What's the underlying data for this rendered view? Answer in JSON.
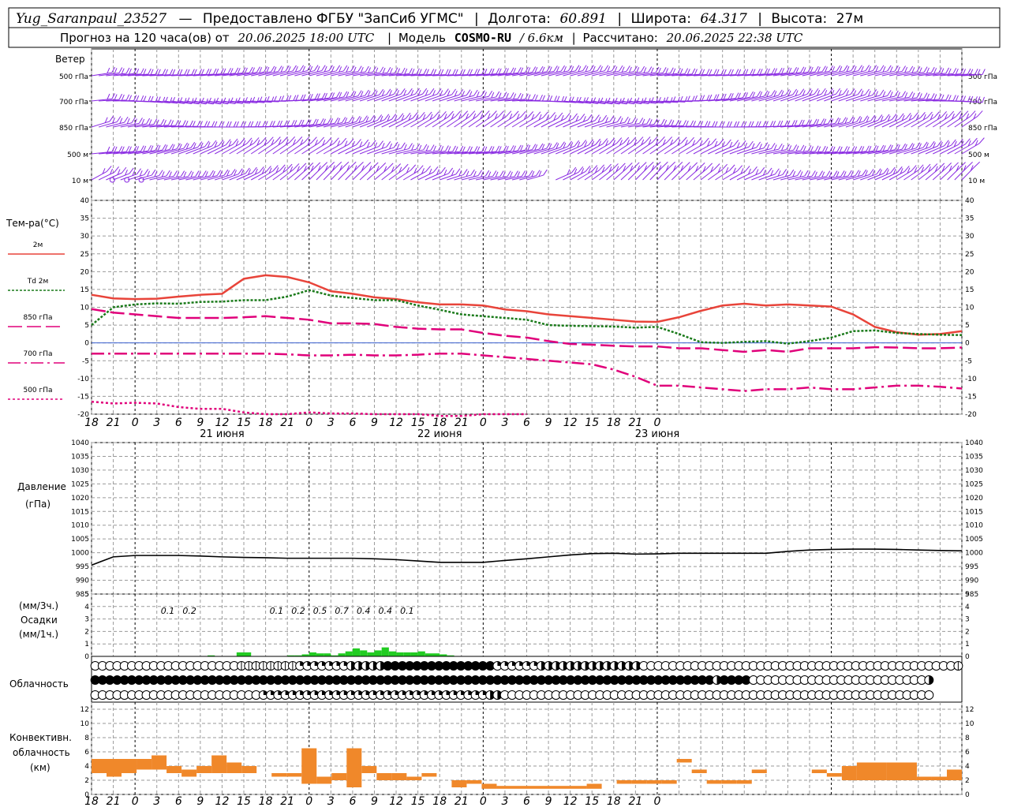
{
  "header": {
    "station": "Yug_Saranpaul_23527",
    "dash": "—",
    "provider": "Предоставлено ФГБУ \"ЗапСиб УГМС\"",
    "lon_label": "Долгота:",
    "lon_value": "60.891",
    "lat_label": "Широта:",
    "lat_value": "64.317",
    "alt_label": "Высота:",
    "alt_value": "27м",
    "forecast_prefix": "Прогноз на 120 часа(ов) от",
    "forecast_time": "20.06.2025 18:00 UTC",
    "model_label": "Модель",
    "model_name": "COSMO-RU",
    "model_res": "/ 6.6км",
    "calc_label": "Рассчитано:",
    "calc_time": "20.06.2025 22:38 UTC"
  },
  "colors": {
    "wind": "#8a2be2",
    "t2m": "#e8443a",
    "td2m": "#1a7a1a",
    "t850": "#e0007a",
    "t700": "#e0007a",
    "t500": "#e0007a",
    "pressure": "#000000",
    "precip": "#22cc22",
    "convective": "#f0882a",
    "grid": "#9a9a9a"
  },
  "labels": {
    "wind_title": "Ветер",
    "wind_levels": [
      "500 гПа",
      "700 гПа",
      "850 гПа",
      "500 м",
      "10 м"
    ],
    "temp_title": "Тем-ра(°C)",
    "temp_legend": [
      "2м",
      "Td 2м",
      "850 гПа",
      "700 гПа",
      "500 гПа"
    ],
    "pressure_title": "Давление",
    "pressure_unit": "(гПа)",
    "precip_unit1": "(мм/3ч.)",
    "precip_title": "Осадки",
    "precip_unit2": "(мм/1ч.)",
    "cloud_title": "Облачность",
    "conv_title1": "Конвективн.",
    "conv_title2": "облачность",
    "conv_unit": "(км)"
  },
  "x_axis": {
    "hour_ticks": [
      "18",
      "21",
      "0",
      "3",
      "6",
      "9",
      "12",
      "15",
      "18",
      "21",
      "0",
      "3",
      "6",
      "9",
      "12",
      "15",
      "18",
      "21",
      "0",
      "3",
      "6",
      "9",
      "12",
      "15",
      "18",
      "21",
      "0"
    ],
    "days": [
      "21 июня",
      "22 июня",
      "23 июня"
    ]
  },
  "chart_data": [
    {
      "type": "line",
      "title": "Тем-ра(°C)",
      "ylim": [
        -20,
        40
      ],
      "yticks": [
        -20,
        -15,
        -10,
        -5,
        0,
        5,
        10,
        15,
        20,
        25,
        30,
        35,
        40
      ],
      "x_hours": [
        0,
        3,
        6,
        9,
        12,
        15,
        18,
        21,
        24,
        27,
        30,
        33,
        36,
        39,
        42,
        45,
        48,
        51,
        54,
        57,
        60,
        63,
        66,
        69,
        72,
        75,
        78,
        81,
        84,
        87,
        90,
        93,
        96,
        99,
        102,
        105,
        108,
        111,
        114,
        117,
        120
      ],
      "series": [
        {
          "name": "2м",
          "values": [
            13.5,
            12.5,
            12.3,
            12.4,
            13,
            13.5,
            13.8,
            18,
            19,
            18.5,
            17,
            14.5,
            13.8,
            12.8,
            12.3,
            11.4,
            10.8,
            10.8,
            10.5,
            9.4,
            8.9,
            8,
            7.5,
            7,
            6.5,
            6,
            5.9,
            7.2,
            9,
            10.5,
            11,
            10.5,
            10.8,
            10.5,
            10.2,
            8,
            4.5,
            3,
            2.3,
            2.5,
            3.3
          ]
        },
        {
          "name": "Td 2м",
          "values": [
            5,
            10,
            10.8,
            11.1,
            11,
            11.5,
            11.6,
            12,
            12,
            13,
            14.8,
            13.3,
            12.6,
            12,
            12,
            10.5,
            9.3,
            8,
            7.5,
            7,
            6.5,
            5,
            4.8,
            4.7,
            4.6,
            4.3,
            4.5,
            2.5,
            0.2,
            0,
            0.3,
            0.5,
            -0.2,
            0.5,
            1.5,
            3.3,
            3.5,
            2.8,
            2.5,
            2.3,
            2.2
          ]
        },
        {
          "name": "850 гПа",
          "values": [
            9.5,
            8.5,
            8,
            7.5,
            7,
            7,
            7,
            7.2,
            7.5,
            7,
            6.5,
            5.5,
            5.5,
            5.3,
            4.5,
            4,
            3.8,
            3.8,
            2.8,
            2,
            1.5,
            0.5,
            -0.3,
            -0.5,
            -0.8,
            -1,
            -1,
            -1.5,
            -1.5,
            -2,
            -2.5,
            -2,
            -2.5,
            -1.5,
            -1.5,
            -1.5,
            -1.2,
            -1.3,
            -1.5,
            -1.5,
            -1.3
          ]
        },
        {
          "name": "700 гПа",
          "values": [
            -3,
            -3,
            -3,
            -3,
            -3,
            -3,
            -3,
            -3,
            -3,
            -3.2,
            -3.5,
            -3.5,
            -3.3,
            -3.5,
            -3.5,
            -3.3,
            -3,
            -3,
            -3.5,
            -4,
            -4.5,
            -5,
            -5.5,
            -6,
            -7.5,
            -9.5,
            -12,
            -12,
            -12.5,
            -13,
            -13.5,
            -13,
            -13,
            -12.5,
            -13,
            -13,
            -12.5,
            -12,
            -12,
            -12.3,
            -12.8
          ]
        },
        {
          "name": "500 гПа",
          "values": [
            -16.5,
            -17,
            -16.8,
            -17,
            -18,
            -18.5,
            -18.5,
            -19.5,
            -20,
            -20,
            -19.5,
            -19.8,
            -19.8,
            -20,
            -20,
            -20,
            -20.5,
            -20.5,
            -20,
            -20,
            -20
          ]
        }
      ]
    },
    {
      "type": "line",
      "title": "Давление",
      "ylabel": "(гПа)",
      "ylim": [
        985,
        1040
      ],
      "yticks": [
        985,
        990,
        995,
        1000,
        1005,
        1010,
        1015,
        1020,
        1025,
        1030,
        1035,
        1040
      ],
      "x_hours": [
        0,
        3,
        6,
        9,
        12,
        15,
        18,
        21,
        24,
        27,
        30,
        33,
        36,
        39,
        42,
        45,
        48,
        51,
        54,
        57,
        60,
        63,
        66,
        69,
        72,
        75,
        78,
        81,
        84,
        87,
        90,
        93,
        96,
        99,
        102,
        105,
        108,
        111,
        114,
        117,
        120
      ],
      "series": [
        {
          "name": "",
          "values": [
            995.5,
            998.5,
            999,
            999,
            999,
            998.8,
            998.5,
            998.3,
            998.2,
            998,
            998,
            998,
            998,
            997.8,
            997.5,
            997,
            996.5,
            996.5,
            996.5,
            997.2,
            997.8,
            998.5,
            999.2,
            999.7,
            999.8,
            999.5,
            999.6,
            999.8,
            999.8,
            999.8,
            999.8,
            999.8,
            1000.5,
            1001,
            1001.2,
            1001.3,
            1001.3,
            1001.2,
            1001,
            1000.8,
            1000.7
          ]
        }
      ]
    },
    {
      "type": "bar",
      "title": "Осадки",
      "ylabel": "(мм/3ч.) (мм/1ч.)",
      "ylim": [
        0,
        5
      ],
      "yticks": [
        0,
        1,
        2,
        3,
        4,
        5
      ],
      "labels_3h": [
        {
          "hour": 12,
          "text": "0.1"
        },
        {
          "hour": 15,
          "text": "0.2"
        },
        {
          "hour": 27,
          "text": "0.1"
        },
        {
          "hour": 30,
          "text": "0.2"
        },
        {
          "hour": 33,
          "text": "0.5"
        },
        {
          "hour": 36,
          "text": "0.7"
        },
        {
          "hour": 39,
          "text": "0.4"
        },
        {
          "hour": 42,
          "text": "0.4"
        },
        {
          "hour": 45,
          "text": "0.1"
        }
      ],
      "hourly": [
        [
          16,
          0.05
        ],
        [
          20,
          0.2
        ],
        [
          21,
          0.2
        ],
        [
          27,
          0.05
        ],
        [
          28,
          0.05
        ],
        [
          29,
          0.1
        ],
        [
          30,
          0.2
        ],
        [
          31,
          0.15
        ],
        [
          32,
          0.15
        ],
        [
          33,
          0.05
        ],
        [
          34,
          0.15
        ],
        [
          35,
          0.25
        ],
        [
          36,
          0.4
        ],
        [
          37,
          0.3
        ],
        [
          38,
          0.2
        ],
        [
          39,
          0.3
        ],
        [
          40,
          0.45
        ],
        [
          41,
          0.25
        ],
        [
          42,
          0.2
        ],
        [
          43,
          0.2
        ],
        [
          44,
          0.2
        ],
        [
          45,
          0.25
        ],
        [
          46,
          0.15
        ],
        [
          47,
          0.15
        ],
        [
          48,
          0.1
        ],
        [
          49,
          0.05
        ]
      ]
    },
    {
      "type": "bar",
      "title": "Конвективн. облачность",
      "ylabel": "(км)",
      "ylim": [
        0,
        13
      ],
      "yticks": [
        0,
        2,
        4,
        6,
        8,
        10,
        12
      ],
      "bars": [
        [
          0,
          3,
          3,
          5
        ],
        [
          1,
          2,
          2.5,
          5
        ],
        [
          2,
          3,
          3,
          5
        ],
        [
          3,
          4,
          3.5,
          5
        ],
        [
          4,
          5,
          3.5,
          5.5
        ],
        [
          5,
          6,
          3,
          4
        ],
        [
          6,
          7,
          2.5,
          3.5
        ],
        [
          7,
          8,
          3,
          4
        ],
        [
          8,
          9,
          3,
          5.5
        ],
        [
          9,
          10,
          3,
          4.5
        ],
        [
          10,
          11,
          3,
          4
        ],
        [
          12,
          13,
          2.5,
          3
        ],
        [
          13,
          14,
          2.5,
          3
        ],
        [
          14,
          15,
          1.5,
          6.5
        ],
        [
          15,
          16,
          1.5,
          2.5
        ],
        [
          16,
          17,
          2,
          3
        ],
        [
          17,
          18,
          1,
          6.5
        ],
        [
          18,
          19,
          3,
          4
        ],
        [
          19,
          20,
          2,
          3
        ],
        [
          20,
          21,
          2,
          3
        ],
        [
          21,
          22,
          2,
          2.5
        ],
        [
          22,
          23,
          2.5,
          3
        ],
        [
          24,
          25,
          1,
          2
        ],
        [
          25,
          26,
          1.5,
          2
        ],
        [
          26,
          27,
          0.8,
          1.5
        ],
        [
          27,
          33,
          0.8,
          1.2
        ],
        [
          33,
          34,
          0.8,
          1.5
        ],
        [
          35,
          36,
          1.5,
          2
        ],
        [
          36,
          37,
          1.5,
          2
        ],
        [
          37,
          38,
          1.5,
          2
        ],
        [
          38,
          39,
          1.5,
          2
        ],
        [
          39,
          40,
          4.5,
          5
        ],
        [
          40,
          41,
          3,
          3.5
        ],
        [
          41,
          42,
          1.5,
          2
        ],
        [
          42,
          43,
          1.5,
          2
        ],
        [
          43,
          44,
          1.5,
          2
        ],
        [
          44,
          45,
          3,
          3.5
        ],
        [
          48,
          49,
          3,
          3.5
        ],
        [
          49,
          50,
          2.5,
          3
        ],
        [
          50,
          51,
          2,
          4
        ],
        [
          51,
          53,
          2,
          4.5
        ],
        [
          53,
          55,
          2,
          4.5
        ],
        [
          55,
          56,
          2,
          2.5
        ],
        [
          56,
          57,
          2,
          2.5
        ],
        [
          57,
          58,
          2,
          3.5
        ]
      ]
    }
  ],
  "clouds": {
    "high": "ooooooooooooooooooooddddddddqqqqqqqhhhhhfffffffffffffffqqqqqqhhhhhhhhhhhhhhoooooooooooooooooooooooooooooooooooooooooood",
    "mid": "fffffffffffffffffffffffffffffffffffffffffffffffffffffffffffffffffffffffffffffffffffffhffffooooooooooooooooooooooooh",
    "low": "oooooooooooooooooooooooqqqqqqqqqqqqqqqqqqqqqqqqqqqqqqqhhooooooooooooooooooooooooooooooooooooooooooooooooooooooooooo"
  },
  "wind": {
    "levels": [
      "500 гПа",
      "700 гПа",
      "850 гПа",
      "500 м",
      "10 м"
    ]
  }
}
